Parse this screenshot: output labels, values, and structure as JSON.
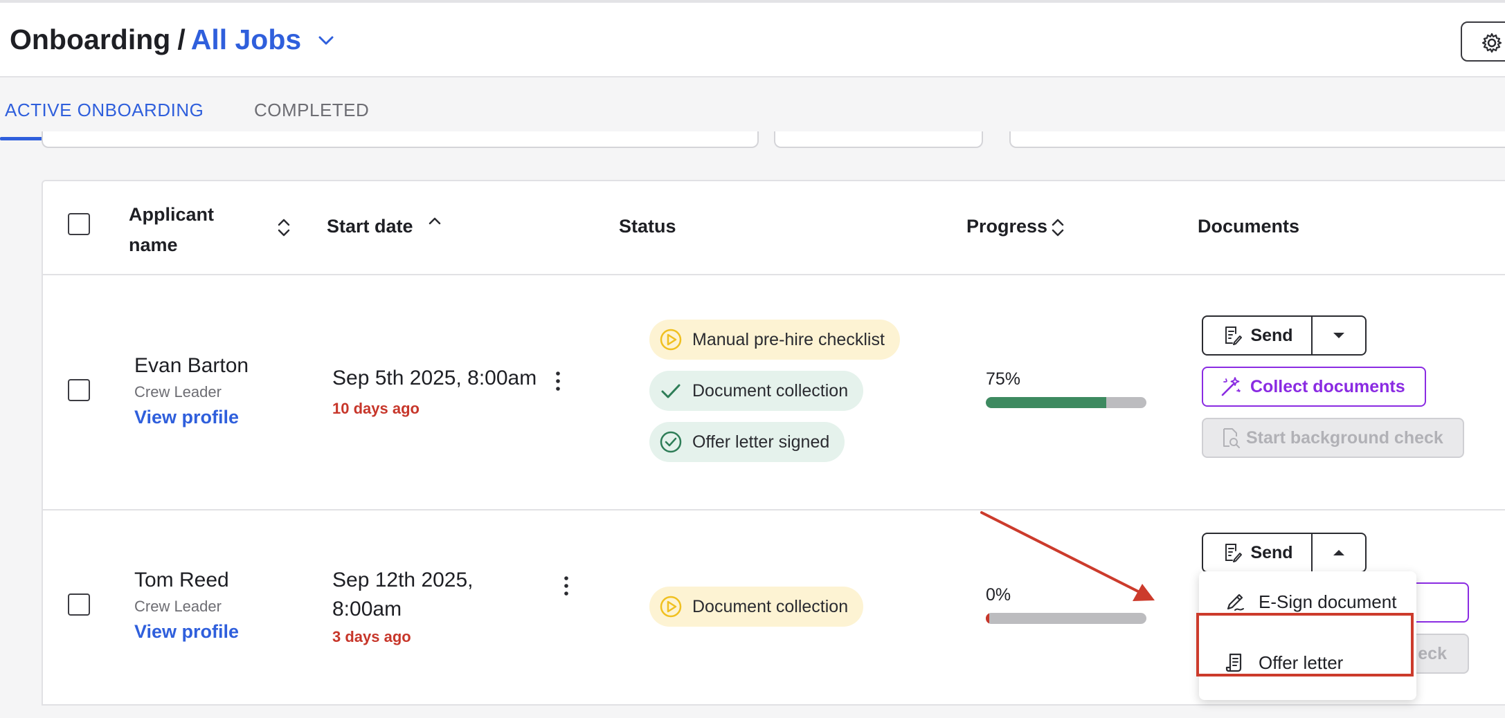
{
  "header": {
    "breadcrumb_root": "Onboarding",
    "breadcrumb_sep": "/",
    "breadcrumb_current": "All Jobs"
  },
  "tabs": [
    {
      "label": "ACTIVE ONBOARDING",
      "active": true
    },
    {
      "label": "COMPLETED",
      "active": false
    }
  ],
  "table": {
    "columns": {
      "applicant": "Applicant name",
      "start_date": "Start date",
      "status": "Status",
      "progress": "Progress",
      "documents": "Documents"
    },
    "rows": [
      {
        "name": "Evan Barton",
        "role": "Crew Leader",
        "link": "View profile",
        "date": "Sep 5th 2025, 8:00am",
        "ago": "10 days ago",
        "statuses": [
          {
            "label": "Manual pre-hire checklist",
            "state": "in-progress"
          },
          {
            "label": "Document collection",
            "state": "done"
          },
          {
            "label": "Offer letter signed",
            "state": "done-circle"
          }
        ],
        "progress_label": "75%",
        "progress_value": 0.75,
        "send_label": "Send",
        "collect_label": "Collect documents",
        "background_label": "Start background check"
      },
      {
        "name": "Tom Reed",
        "role": "Crew Leader",
        "link": "View profile",
        "date": "Sep 12th 2025, 8:00am",
        "ago": "3 days ago",
        "statuses": [
          {
            "label": "Document collection",
            "state": "in-progress"
          }
        ],
        "progress_label": "0%",
        "progress_value": 0,
        "send_label": "Send",
        "background_partial": "eck"
      }
    ]
  },
  "send_menu": {
    "items": [
      {
        "label": "E-Sign document",
        "icon": "signature-pen-icon"
      },
      {
        "label": "Offer letter",
        "icon": "scroll-document-icon"
      }
    ]
  },
  "colors": {
    "accent": "#2f5fdc",
    "success": "#3d8a60",
    "warning_bg": "#fdf3d3",
    "success_bg": "#e5f2ec",
    "danger": "#c7362a",
    "purple": "#8a2be2",
    "annotation": "#cc3b2c"
  }
}
